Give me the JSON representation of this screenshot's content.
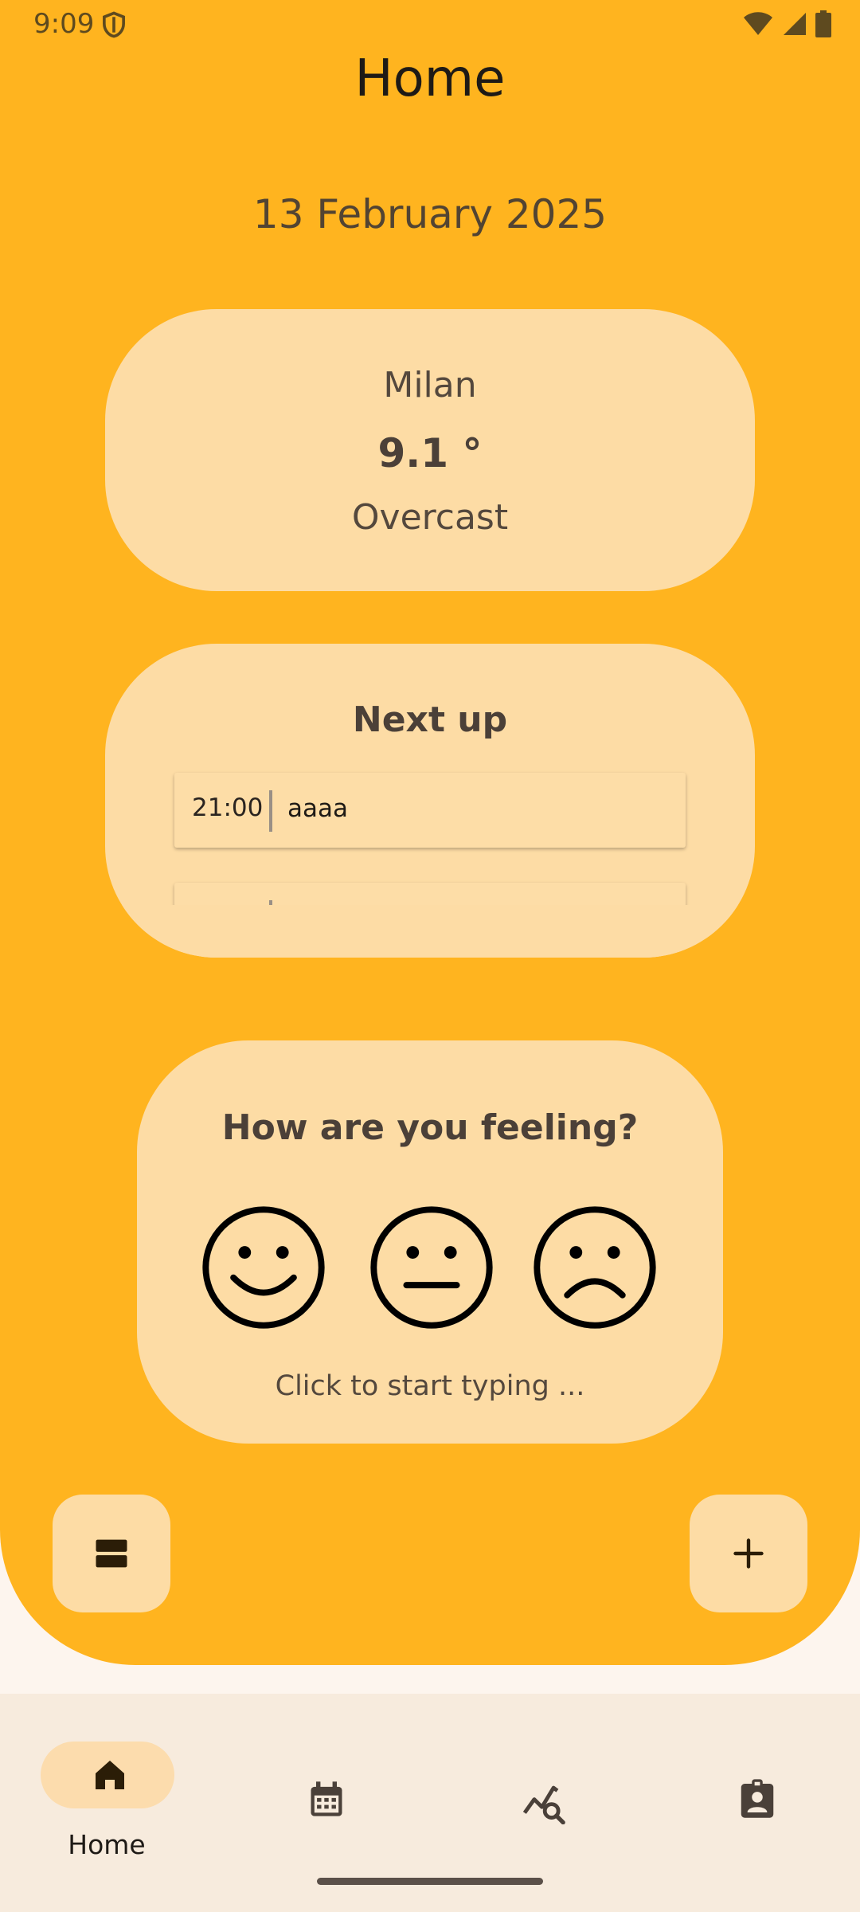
{
  "status_bar": {
    "time": "9:09",
    "icons": [
      "shield-icon",
      "wifi-icon",
      "signal-icon",
      "battery-icon"
    ]
  },
  "header": {
    "title": "Home"
  },
  "date": "13 February 2025",
  "weather": {
    "city": "Milan",
    "temperature": "9.1 °",
    "condition": "Overcast"
  },
  "next_up": {
    "title": "Next up",
    "events": [
      {
        "time": "21:00",
        "name": "aaaa"
      }
    ]
  },
  "mood": {
    "question": "How are you feeling?",
    "faces": [
      "happy-face-icon",
      "neutral-face-icon",
      "sad-face-icon"
    ],
    "hint": "Click to start typing ..."
  },
  "actions": {
    "menu_icon": "view-agenda-icon",
    "add_icon": "plus-icon"
  },
  "bottom_nav": {
    "items": [
      {
        "label": "Home",
        "icon": "home-icon",
        "selected": true
      },
      {
        "label": "",
        "icon": "calendar-icon",
        "selected": false
      },
      {
        "label": "",
        "icon": "analytics-search-icon",
        "selected": false
      },
      {
        "label": "",
        "icon": "contact-badge-icon",
        "selected": false
      }
    ]
  },
  "colors": {
    "accent": "#ffb41f",
    "card": "#fddca5",
    "nav_background": "#f7ebdd",
    "page_background": "#fdf5ee"
  }
}
